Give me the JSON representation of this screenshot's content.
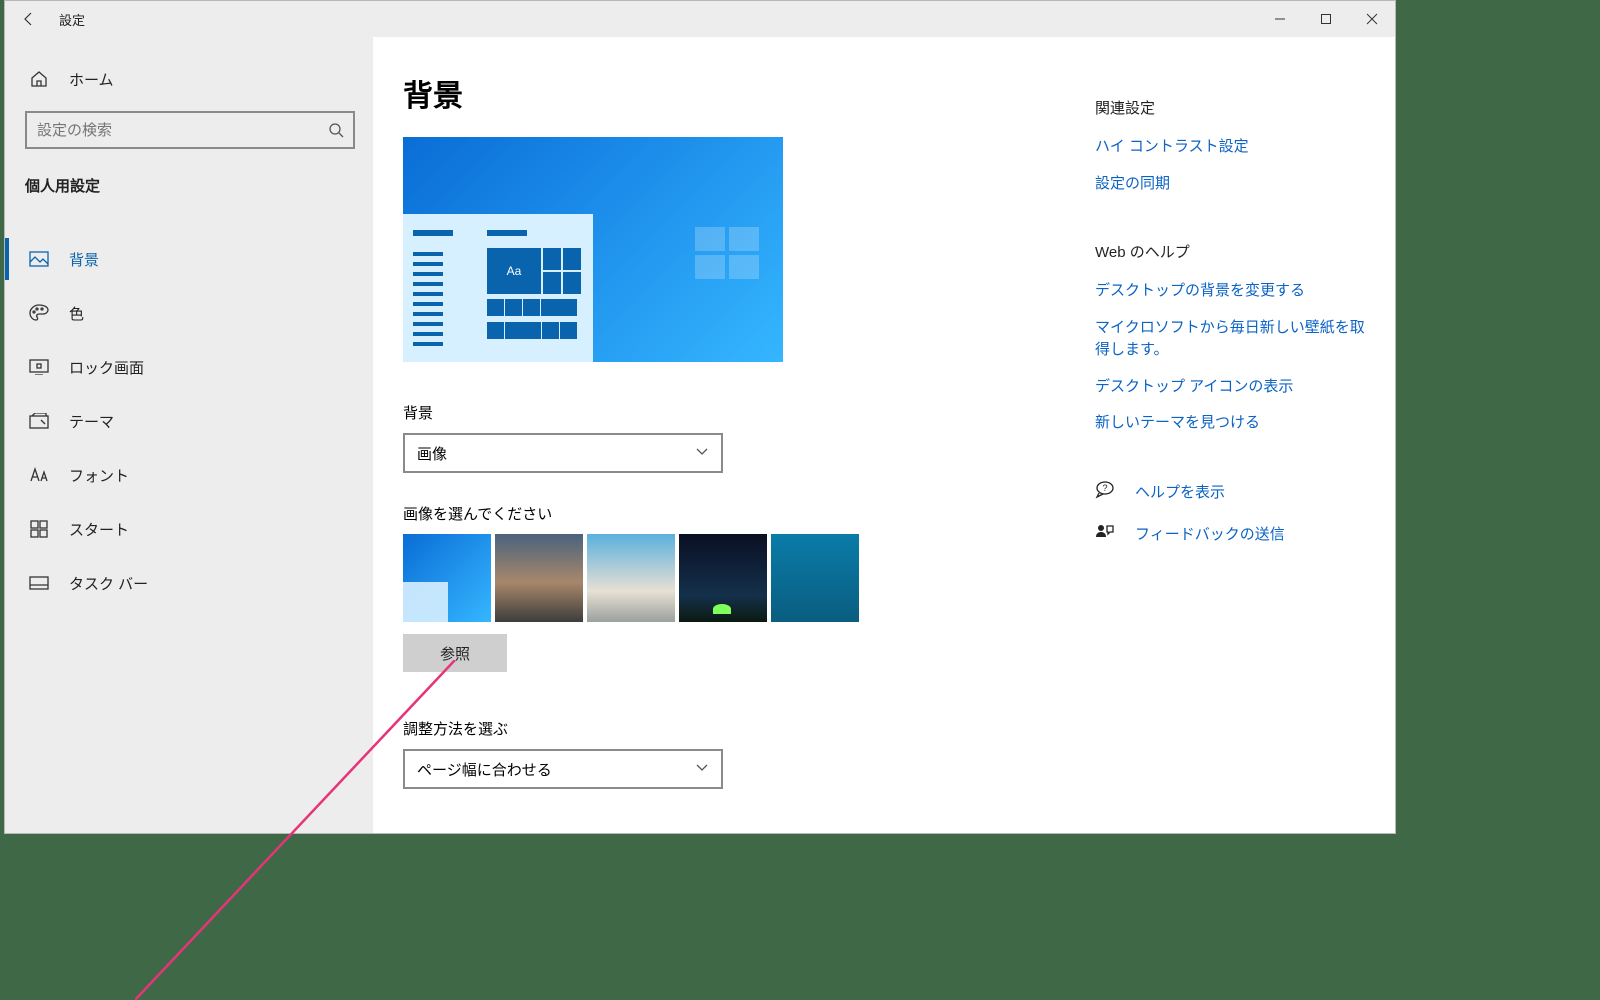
{
  "titlebar": {
    "title": "設定"
  },
  "sidebar": {
    "home": "ホーム",
    "search_placeholder": "設定の検索",
    "section": "個人用設定",
    "items": [
      {
        "label": "背景"
      },
      {
        "label": "色"
      },
      {
        "label": "ロック画面"
      },
      {
        "label": "テーマ"
      },
      {
        "label": "フォント"
      },
      {
        "label": "スタート"
      },
      {
        "label": "タスク バー"
      }
    ]
  },
  "main": {
    "heading": "背景",
    "preview_tile_text": "Aa",
    "bg_label": "背景",
    "bg_select_value": "画像",
    "choose_label": "画像を選んでください",
    "browse": "参照",
    "fit_label": "調整方法を選ぶ",
    "fit_select_value": "ページ幅に合わせる"
  },
  "related": {
    "title": "関連設定",
    "links": [
      "ハイ コントラスト設定",
      "設定の同期"
    ],
    "web_title": "Web のヘルプ",
    "web_links": [
      "デスクトップの背景を変更する",
      "マイクロソフトから毎日新しい壁紙を取得します。",
      "デスクトップ アイコンの表示",
      "新しいテーマを見つける"
    ],
    "help": "ヘルプを表示",
    "feedback": "フィードバックの送信"
  }
}
